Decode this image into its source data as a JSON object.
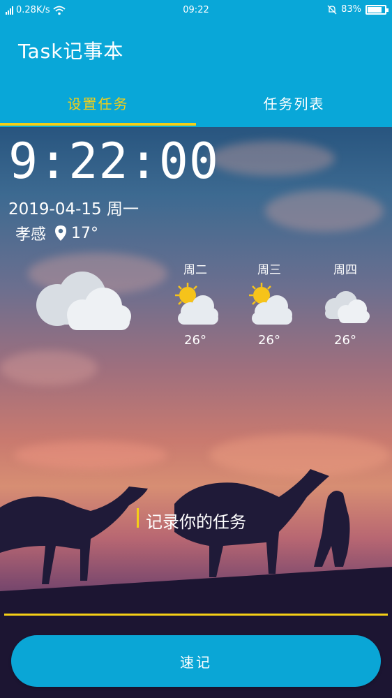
{
  "status_bar": {
    "network_speed": "0.28K/s",
    "time": "09:22",
    "battery": "83%",
    "battery_level": 0.83,
    "icons": [
      "signal-icon",
      "wifi-icon",
      "notification-muted-icon",
      "battery-icon"
    ]
  },
  "toolbar": {
    "title": "Task记事本"
  },
  "tabs": [
    {
      "label": "设置任务",
      "active": true
    },
    {
      "label": "任务列表",
      "active": false
    }
  ],
  "colors": {
    "primary": "#09a7d8",
    "accent": "#f5cf16",
    "text": "#ffffff"
  },
  "clock": {
    "time": "9:22:00",
    "date": "2019-04-15 周一"
  },
  "weather": {
    "city": "孝感",
    "current_temp": "17°",
    "current_icon": "cloudy-icon",
    "forecast": [
      {
        "day": "周二",
        "icon": "partly-cloudy-icon",
        "temp": "26°"
      },
      {
        "day": "周三",
        "icon": "partly-cloudy-icon",
        "temp": "26°"
      },
      {
        "day": "周四",
        "icon": "cloudy-icon",
        "temp": "26°"
      }
    ]
  },
  "task": {
    "placeholder": "记录你的任务",
    "value": ""
  },
  "submit_label": "速记"
}
